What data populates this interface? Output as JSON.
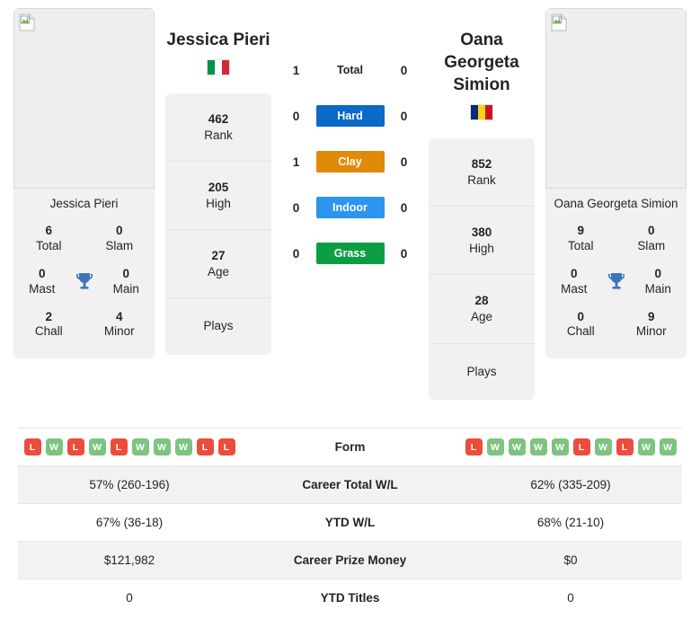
{
  "players": {
    "left": {
      "name": "Jessica Pieri",
      "caption": "Jessica Pieri",
      "flag": {
        "name": "italy-flag",
        "colors": [
          "#009246",
          "#ffffff",
          "#ce2b37"
        ]
      },
      "titles": {
        "total": "6",
        "total_label": "Total",
        "slam": "0",
        "slam_label": "Slam",
        "mast": "0",
        "mast_label": "Mast",
        "main": "0",
        "main_label": "Main",
        "chall": "2",
        "chall_label": "Chall",
        "minor": "4",
        "minor_label": "Minor"
      },
      "rank": "462",
      "rank_label": "Rank",
      "high": "205",
      "high_label": "High",
      "age": "27",
      "age_label": "Age",
      "plays": "",
      "plays_label": "Plays"
    },
    "right": {
      "name": "Oana Georgeta Simion",
      "caption": "Oana Georgeta Simion",
      "flag": {
        "name": "romania-flag",
        "colors": [
          "#002b7f",
          "#fcd116",
          "#ce1126"
        ]
      },
      "titles": {
        "total": "9",
        "total_label": "Total",
        "slam": "0",
        "slam_label": "Slam",
        "mast": "0",
        "mast_label": "Mast",
        "main": "0",
        "main_label": "Main",
        "chall": "0",
        "chall_label": "Chall",
        "minor": "9",
        "minor_label": "Minor"
      },
      "rank": "852",
      "rank_label": "Rank",
      "high": "380",
      "high_label": "High",
      "age": "28",
      "age_label": "Age",
      "plays": "",
      "plays_label": "Plays"
    }
  },
  "head_to_head": {
    "rows": [
      {
        "label": "Total",
        "left": "1",
        "right": "0",
        "color": "",
        "styled": false
      },
      {
        "label": "Hard",
        "left": "0",
        "right": "0",
        "color": "#0b69c7",
        "styled": true
      },
      {
        "label": "Clay",
        "left": "1",
        "right": "0",
        "color": "#e18a09",
        "styled": true
      },
      {
        "label": "Indoor",
        "left": "0",
        "right": "0",
        "color": "#2b95f0",
        "styled": true
      },
      {
        "label": "Grass",
        "left": "0",
        "right": "0",
        "color": "#0c9e45",
        "styled": true
      }
    ]
  },
  "icons": {
    "trophy": "trophy-icon",
    "broken_image": "broken-image-icon"
  },
  "colors": {
    "win_badge": "#7dc47f",
    "loss_badge": "#ec4c3b",
    "card_bg": "#f1f1f1",
    "row_alt_bg": "#f2f2f2"
  },
  "stats_table": {
    "rows": [
      {
        "label": "Form",
        "type": "form",
        "left_form": [
          "L",
          "W",
          "L",
          "W",
          "L",
          "W",
          "W",
          "W",
          "L",
          "L"
        ],
        "right_form": [
          "L",
          "W",
          "W",
          "W",
          "W",
          "L",
          "W",
          "L",
          "W",
          "W"
        ]
      },
      {
        "label": "Career Total W/L",
        "type": "text",
        "left": "57% (260-196)",
        "right": "62% (335-209)"
      },
      {
        "label": "YTD W/L",
        "type": "text",
        "left": "67% (36-18)",
        "right": "68% (21-10)"
      },
      {
        "label": "Career Prize Money",
        "type": "text",
        "left": "$121,982",
        "right": "$0"
      },
      {
        "label": "YTD Titles",
        "type": "text",
        "left": "0",
        "right": "0"
      }
    ]
  }
}
